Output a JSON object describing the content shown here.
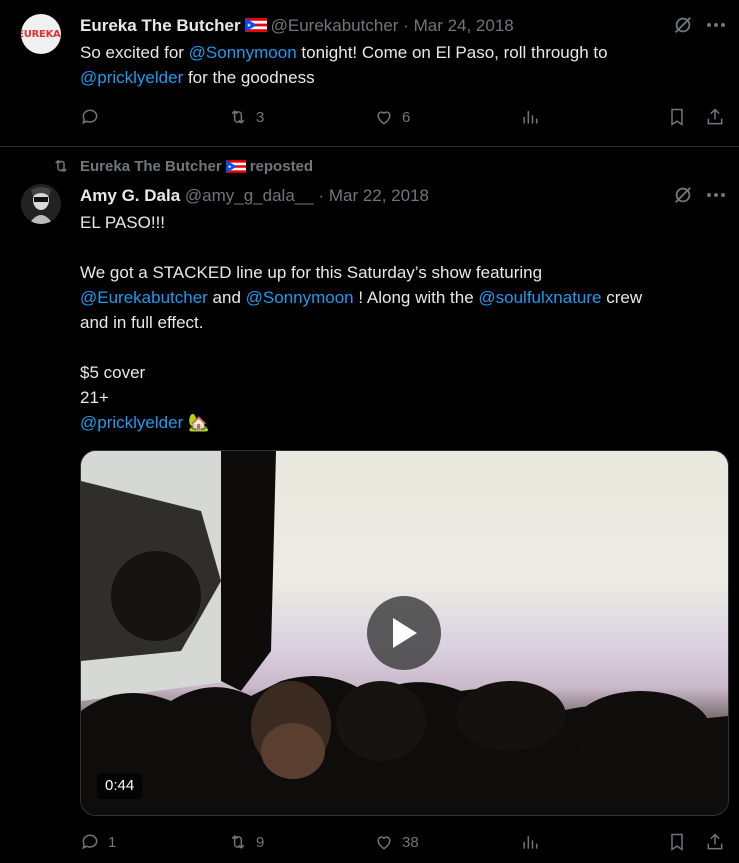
{
  "tweet1": {
    "name": "Eureka The Butcher",
    "handle": "@Eurekabutcher",
    "separator": "·",
    "date": "Mar 24, 2018",
    "avatar_text": "EUREKA!",
    "text_1": "So excited for ",
    "link_1": "@Sonnymoon",
    "text_2": " tonight! Come on El Paso, roll through to",
    "link_2": "@pricklyelder",
    "text_3": " for the goodness",
    "retweets": "3",
    "likes": "6"
  },
  "repost_banner": {
    "name": "Eureka The Butcher",
    "label": "reposted"
  },
  "tweet2": {
    "name": "Amy G. Dala",
    "handle": "@amy_g_dala__",
    "separator": "·",
    "date": "Mar 22, 2018",
    "line_1": "EL PASO!!!",
    "line_2": "We got a STACKED line up for this Saturday’s show featuring",
    "link_a": "@Eurekabutcher",
    "and_1": " and ",
    "link_b": "@Sonnymoon",
    "text_b": " ! Along with the ",
    "link_c": "@soulfulxnature",
    "text_c": " crew",
    "line_3": "and in full effect.",
    "line_4": "$5 cover",
    "line_5": "21+",
    "link_d": "@pricklyelder",
    "emoji": "🏡",
    "video_duration": "0:44",
    "replies": "1",
    "retweets": "9",
    "likes": "38"
  },
  "icons": {
    "reply": "reply-icon",
    "retweet": "retweet-icon",
    "like": "heart-icon",
    "views": "views-icon",
    "bookmark": "bookmark-icon",
    "share": "share-icon",
    "grok": "grok-icon",
    "more": "more-icon"
  },
  "colors": {
    "background": "#000000",
    "text": "#e7e9ea",
    "muted": "#71767b",
    "link": "#1d9bf0",
    "divider": "#2f3336"
  }
}
